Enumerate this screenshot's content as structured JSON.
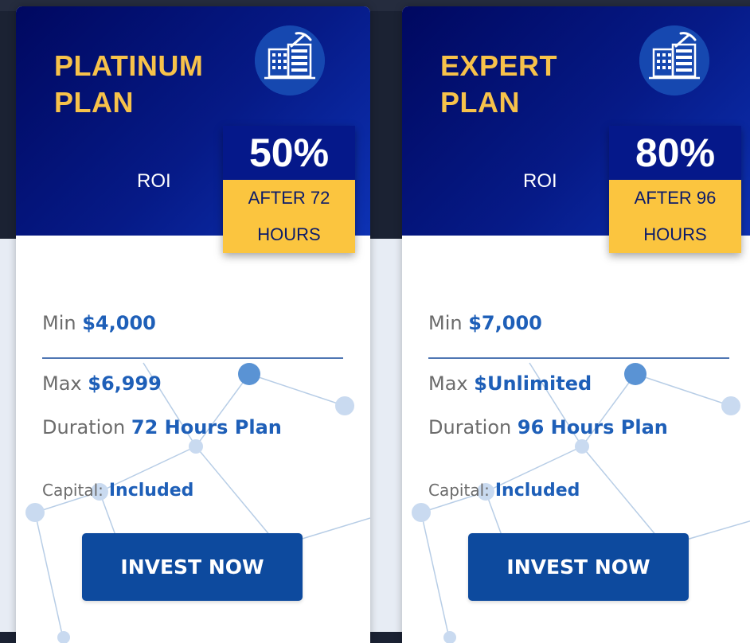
{
  "plans": [
    {
      "title": "PLATINUM\nPLAN",
      "icon": "server-mining-icon",
      "roi_label": "ROI",
      "roi_percent": "50%",
      "roi_after": "AFTER 72\nHOURS",
      "min_label": "Min",
      "min_value": "$4,000",
      "max_label": "Max",
      "max_value": "$6,999",
      "duration_label": "Duration",
      "duration_value": "72 Hours Plan",
      "capital_label": "Capital:",
      "capital_value": "Included",
      "button_label": "INVEST NOW"
    },
    {
      "title": "EXPERT\nPLAN",
      "icon": "server-mining-icon",
      "roi_label": "ROI",
      "roi_percent": "80%",
      "roi_after": "AFTER 96\nHOURS",
      "min_label": "Min",
      "min_value": "$7,000",
      "max_label": "Max",
      "max_value": "$Unlimited",
      "duration_label": "Duration",
      "duration_value": "96 Hours Plan",
      "capital_label": "Capital:",
      "capital_value": "Included",
      "button_label": "INVEST NOW"
    }
  ],
  "colors": {
    "header_dark": "#000860",
    "title_gold": "#f7c24a",
    "roi_gold": "#fbc53f",
    "value_blue": "#1e5fb8",
    "button_blue": "#0d4a9e"
  }
}
